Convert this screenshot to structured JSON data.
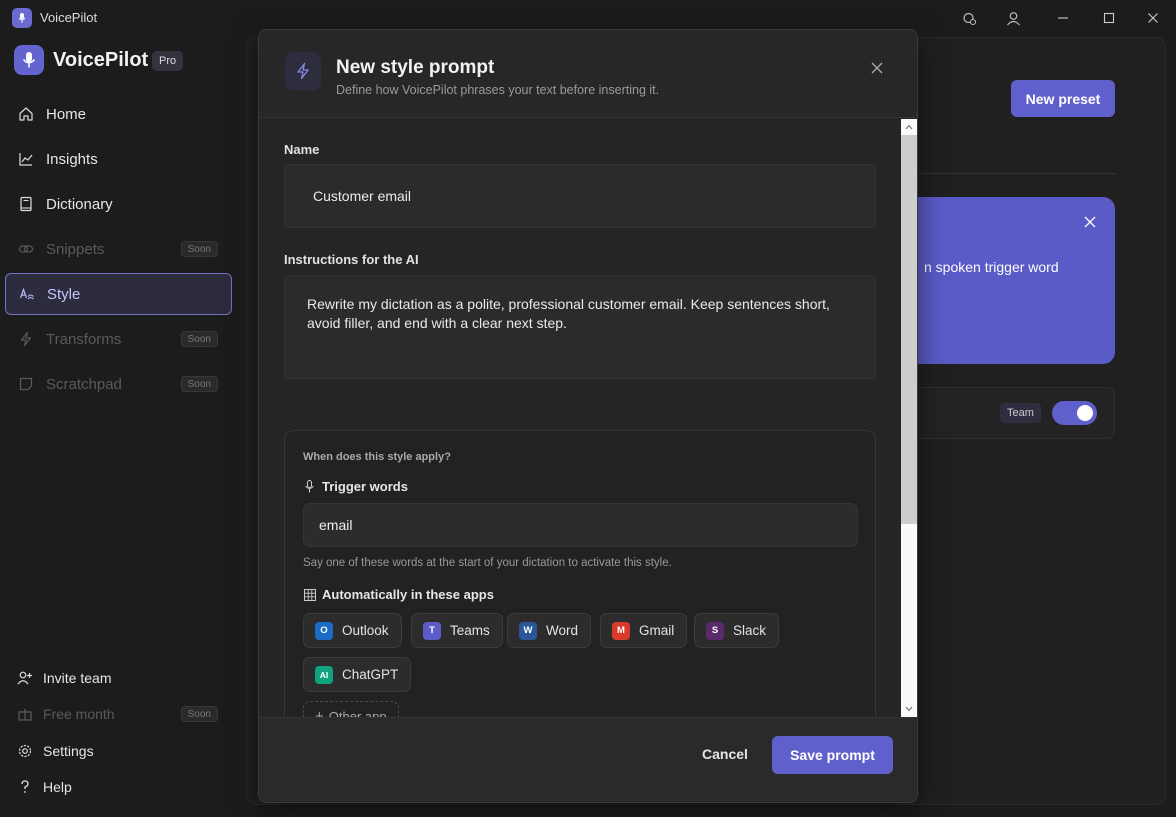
{
  "window": {
    "title": "VoicePilot"
  },
  "brand": {
    "name": "VoicePilot",
    "tier": "Pro"
  },
  "nav": {
    "home": "Home",
    "insights": "Insights",
    "dictionary": "Dictionary",
    "snippets": "Snippets",
    "style": "Style",
    "transforms": "Transforms",
    "scratchpad": "Scratchpad",
    "soon": "Soon"
  },
  "bottom_nav": {
    "invite": "Invite team",
    "free_month": "Free month",
    "settings": "Settings",
    "help": "Help"
  },
  "background": {
    "new_preset": "New preset",
    "card_text": "n spoken trigger word",
    "team_badge": "Team",
    "toggle_on": true
  },
  "modal": {
    "title": "New style prompt",
    "subtitle": "Define how VoicePilot phrases your text before inserting it.",
    "name_label": "Name",
    "name_value": "Customer email",
    "instructions_label": "Instructions for the AI",
    "instructions_value": "Rewrite my dictation as a polite, professional customer email. Keep sentences short, avoid filler, and end with a clear next step.",
    "apply_title": "When does this style apply?",
    "trigger_label": "Trigger words",
    "trigger_value": "email",
    "trigger_help": "Say one of these words at the start of your dictation to activate this style.",
    "apps_label": "Automatically in these apps",
    "apps": [
      {
        "name": "Outlook",
        "letter": "O",
        "color": "#1a6cc4"
      },
      {
        "name": "Teams",
        "letter": "T",
        "color": "#5c5cc8"
      },
      {
        "name": "Word",
        "letter": "W",
        "color": "#2b579a"
      },
      {
        "name": "Gmail",
        "letter": "M",
        "color": "#d93a2b"
      },
      {
        "name": "Slack",
        "letter": "S",
        "color": "#5a2a6a"
      },
      {
        "name": "ChatGPT",
        "letter": "AI",
        "color": "#10a37f"
      }
    ],
    "other_app": "Other app",
    "cancel": "Cancel",
    "save": "Save prompt"
  }
}
